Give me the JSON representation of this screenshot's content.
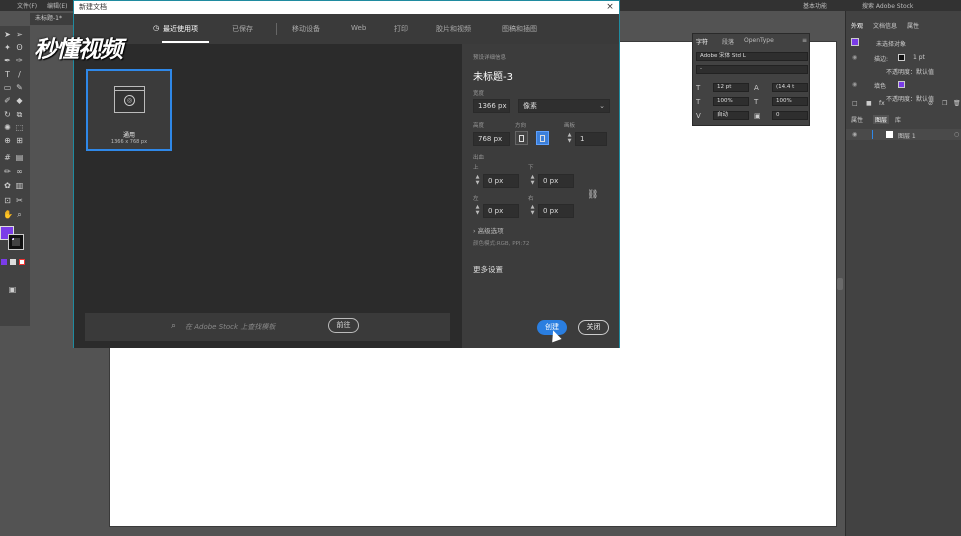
{
  "menubar": {
    "items": [
      "文件(F)",
      "编辑(E)"
    ],
    "workspace": "基本功能",
    "stock_search": "搜索 Adobe Stock"
  },
  "document_tab": "未标题-1*",
  "watermark": "秒懂视频",
  "dialog": {
    "title": "新建文档",
    "close_icon": "×",
    "tabs": [
      {
        "label": "最近使用项",
        "active": true
      },
      {
        "label": "已保存"
      },
      {
        "label": "移动设备"
      },
      {
        "label": "Web"
      },
      {
        "label": "打印"
      },
      {
        "label": "胶片和视频"
      },
      {
        "label": "图稿和插图"
      }
    ],
    "preset": {
      "name": "通用",
      "size": "1366 x 768 px"
    },
    "stock": {
      "placeholder": "在 Adobe Stock 上查找模板",
      "go_label": "前往"
    },
    "details": {
      "section_label": "预设详细信息",
      "doc_name": "未标题-3",
      "width_label": "宽度",
      "width_value": "1366 px",
      "unit_value": "像素",
      "height_label": "高度",
      "height_value": "768 px",
      "orientation_label": "方向",
      "artboards_label": "画板",
      "artboards_value": "1",
      "bleed_label": "出血",
      "bleed_top_label": "上",
      "bleed_top_value": "0 px",
      "bleed_bottom_label": "下",
      "bleed_bottom_value": "0 px",
      "bleed_left_label": "左",
      "bleed_left_value": "0 px",
      "bleed_right_label": "右",
      "bleed_right_value": "0 px",
      "advanced_label": "高级选项",
      "color_mode": "颜色模式:RGB, PPI:72",
      "more_settings": "更多设置",
      "create_label": "创建",
      "close_label": "关闭"
    }
  },
  "character_panel": {
    "tabs": [
      "字符",
      "段落",
      "OpenType"
    ],
    "font_name": "Adobe 宋体 Std L",
    "font_style": "-",
    "font_size": "12 pt",
    "leading": "(14.4 t",
    "vscale": "100%",
    "hscale": "100%",
    "kerning": "自动",
    "tracking": "0"
  },
  "right_panels": {
    "appearance_tabs": [
      "外观",
      "文档信息",
      "属性"
    ],
    "no_selection": "未选择对象",
    "stroke_label": "描边:",
    "stroke_value": "1 pt",
    "opacity_label": "不透明度：默认值",
    "fill_label": "填色",
    "opacity2_label": "不透明度：默认值",
    "layers_tabs": [
      "属性",
      "图层",
      "库"
    ],
    "layer_name": "图层 1"
  },
  "colors": {
    "accent": "#2a7ee0",
    "fill_swatch": "#7a3ce8",
    "dialog_border": "#1f8ba0"
  }
}
